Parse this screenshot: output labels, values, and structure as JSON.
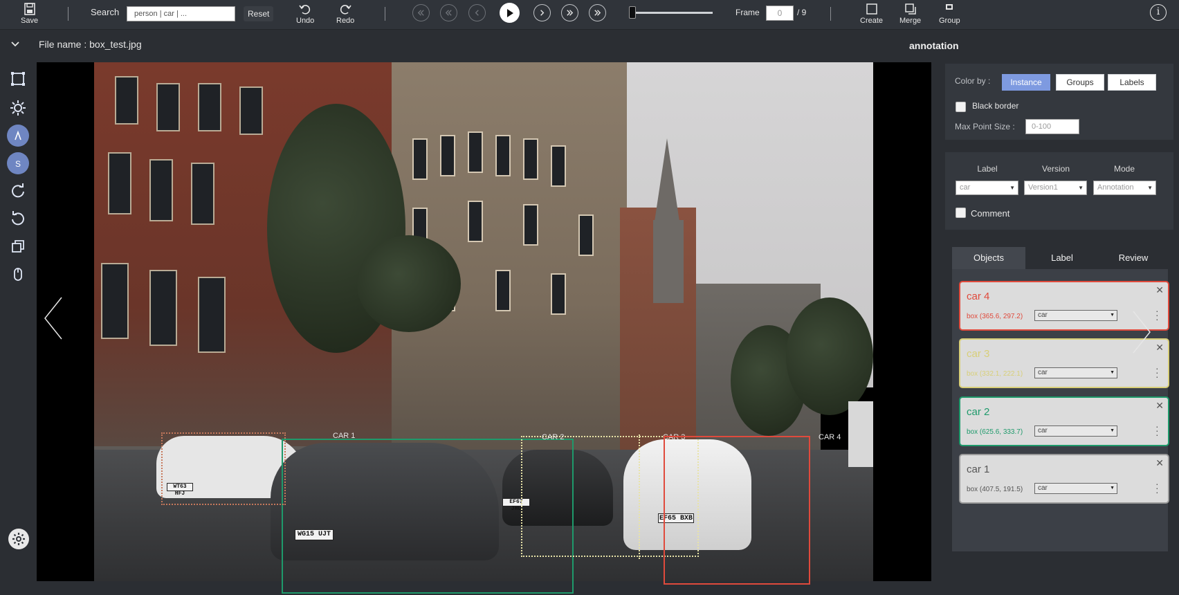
{
  "toolbar": {
    "save_label": "Save",
    "search_label": "Search",
    "search_value": "person | car | ...",
    "reset_label": "Reset",
    "undo_label": "Undo",
    "redo_label": "Redo",
    "frame_label": "Frame",
    "frame_value": "0",
    "frame_total": "/ 9",
    "create_label": "Create",
    "merge_label": "Merge",
    "group_label": "Group"
  },
  "file": {
    "name": "File name : box_test.jpg"
  },
  "panel": {
    "title": "annotation",
    "color_by_label": "Color by :",
    "color_by_options": [
      "Instance",
      "Groups",
      "Labels"
    ],
    "color_by_selected": "Instance",
    "black_border_label": "Black border",
    "max_point_size_label": "Max Point Size :",
    "max_point_size_placeholder": "0-100",
    "label_col": "Label",
    "version_col": "Version",
    "mode_col": "Mode",
    "label_value": "car",
    "version_value": "Version1",
    "mode_value": "Annotation",
    "comment_label": "Comment",
    "tabs": [
      "Objects",
      "Label",
      "Review"
    ],
    "active_tab": "Objects"
  },
  "objects": [
    {
      "name": "car 4",
      "coords": "box (365.6, 297.2)",
      "label": "car",
      "color": "#e04a3c"
    },
    {
      "name": "car 3",
      "coords": "box (332.1, 222.1)",
      "label": "car",
      "color": "#d8cf78"
    },
    {
      "name": "car 2",
      "coords": "box (625.6, 333.7)",
      "label": "car",
      "color": "#1e9a6b"
    },
    {
      "name": "car 1",
      "coords": "box (407.5, 191.5)",
      "label": "car",
      "color": "#555555"
    }
  ],
  "canvas": {
    "box_labels": [
      "CAR 1",
      "CAR 2",
      "CAR 3",
      "CAR 4"
    ],
    "plates": [
      "WG15 UJT",
      "EF67 JHU",
      "EF65 BXB",
      "WT63 HFJ"
    ]
  },
  "colors": {
    "accent": "#7e9ae0",
    "car1_box": "#1e9a6b",
    "car2_box": "#e8e3a8",
    "car4_box": "#e04a3c"
  }
}
